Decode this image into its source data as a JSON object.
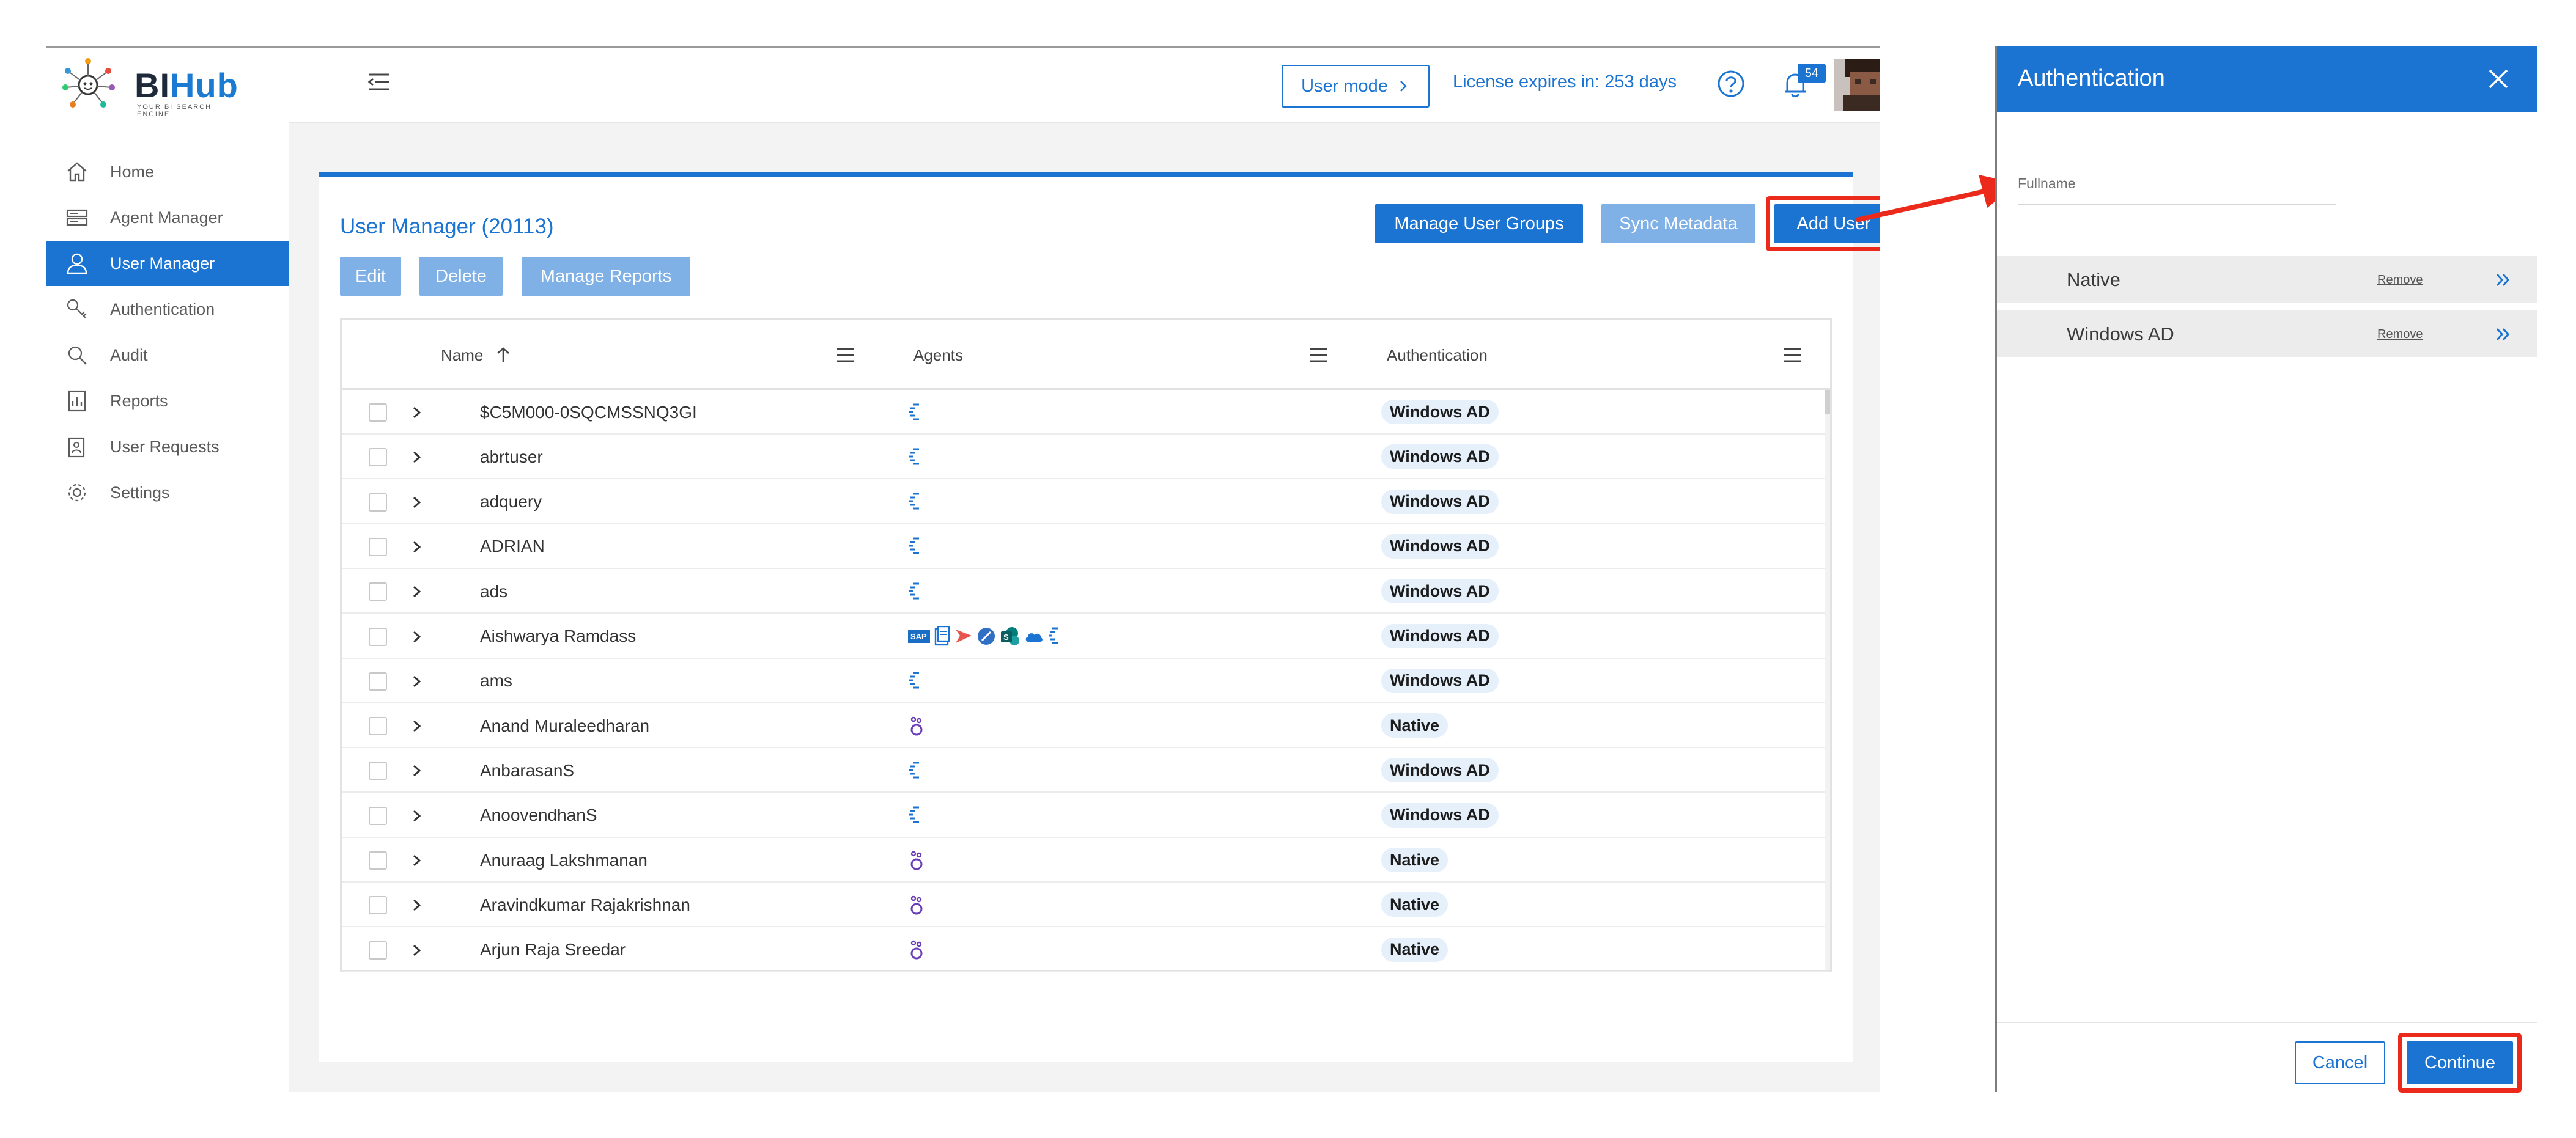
{
  "app": {
    "logo": {
      "brand_bi": "BI",
      "brand_hub": "Hub",
      "tagline": "YOUR BI SEARCH ENGINE"
    },
    "sidebar": {
      "items": [
        {
          "label": "Home",
          "icon": "home-icon"
        },
        {
          "label": "Agent Manager",
          "icon": "server-icon"
        },
        {
          "label": "User Manager",
          "icon": "user-icon",
          "active": true
        },
        {
          "label": "Authentication",
          "icon": "key-icon"
        },
        {
          "label": "Audit",
          "icon": "audit-search-icon"
        },
        {
          "label": "Reports",
          "icon": "report-icon"
        },
        {
          "label": "User Requests",
          "icon": "user-request-icon"
        },
        {
          "label": "Settings",
          "icon": "gear-icon"
        }
      ]
    },
    "topbar": {
      "user_mode_label": "User mode",
      "license_text": "License expires in: 253 days",
      "notification_count": "54"
    },
    "user_manager": {
      "title": "User Manager (20113)",
      "buttons": {
        "manage_user_groups": "Manage User Groups",
        "sync_metadata": "Sync Metadata",
        "add_user": "Add User",
        "edit": "Edit",
        "delete": "Delete",
        "manage_reports": "Manage Reports"
      },
      "columns": {
        "name": "Name",
        "agents": "Agents",
        "authentication": "Authentication"
      },
      "rows": [
        {
          "name": "$C5M000-0SQCMSSNQ3GI",
          "agent_type": "qlik",
          "auth": "Windows AD"
        },
        {
          "name": "abrtuser",
          "agent_type": "qlik",
          "auth": "Windows AD"
        },
        {
          "name": "adquery",
          "agent_type": "qlik",
          "auth": "Windows AD"
        },
        {
          "name": "ADRIAN",
          "agent_type": "qlik",
          "auth": "Windows AD"
        },
        {
          "name": "ads",
          "agent_type": "qlik",
          "auth": "Windows AD"
        },
        {
          "name": "Aishwarya Ramdass",
          "agent_type": "multi",
          "auth": "Windows AD"
        },
        {
          "name": "ams",
          "agent_type": "qlik",
          "auth": "Windows AD"
        },
        {
          "name": "Anand Muraleedharan",
          "agent_type": "native",
          "auth": "Native"
        },
        {
          "name": "AnbarasanS",
          "agent_type": "qlik",
          "auth": "Windows AD"
        },
        {
          "name": "AnoovendhanS",
          "agent_type": "qlik",
          "auth": "Windows AD"
        },
        {
          "name": "Anuraag Lakshmanan",
          "agent_type": "native",
          "auth": "Native"
        },
        {
          "name": "Aravindkumar Rajakrishnan",
          "agent_type": "native",
          "auth": "Native"
        },
        {
          "name": "Arjun Raja Sreedar",
          "agent_type": "native",
          "auth": "Native"
        }
      ]
    }
  },
  "dialog": {
    "title": "Authentication",
    "fullname_label": "Fullname",
    "options": [
      {
        "label": "Native",
        "remove": "Remove"
      },
      {
        "label": "Windows AD",
        "remove": "Remove"
      }
    ],
    "cancel_label": "Cancel",
    "continue_label": "Continue"
  },
  "colors": {
    "primary": "#1b74d1",
    "highlight": "#ec2a1c",
    "disabled": "#7fb0e6",
    "pill": "#e5f0fb"
  }
}
